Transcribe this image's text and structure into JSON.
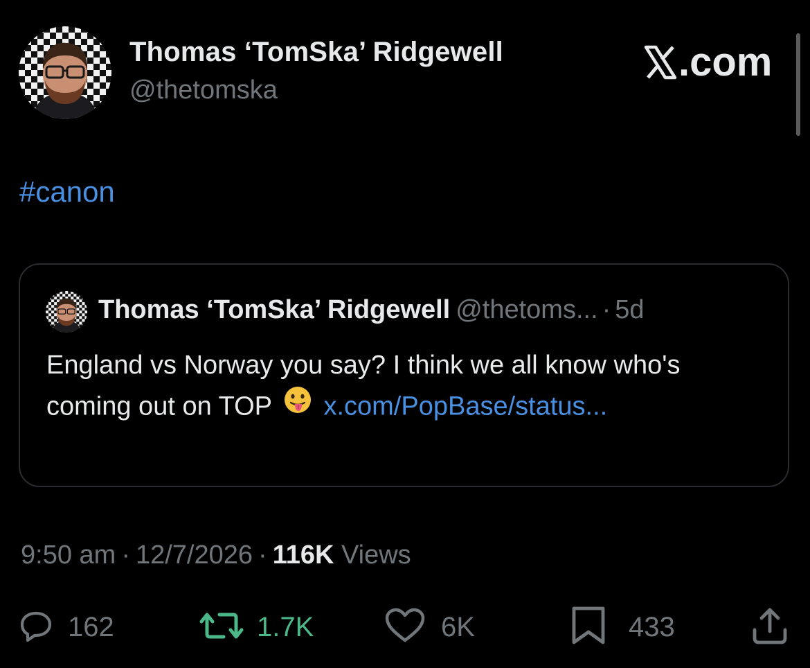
{
  "author": {
    "name": "Thomas ‘TomSka’ Ridgewell",
    "handle": "@thetomska"
  },
  "site_label": ".com",
  "post": {
    "text": "#canon"
  },
  "quoted_post": {
    "author_name": "Thomas ‘TomSka’ Ridgewell",
    "author_handle": "@thetoms...",
    "separator": "·",
    "time_ago": "5d",
    "text": "England vs Norway you say? I think we all know who's coming out on TOP",
    "emoji": "😛",
    "link_text": "x.com/PopBase/status..."
  },
  "meta": {
    "time": "9:50 am",
    "separator": "·",
    "date": "12/7/2026",
    "views_count": "116K",
    "views_label": "Views"
  },
  "actions": {
    "replies": "162",
    "reposts": "1.7K",
    "likes": "6K",
    "bookmarks": "433"
  },
  "icons": {
    "reply": "reply-icon",
    "repost": "repost-icon",
    "like": "heart-icon",
    "bookmark": "bookmark-icon",
    "share": "share-icon",
    "brand": "x-logo-icon"
  },
  "colors": {
    "background": "#000000",
    "text": "#e7e9ea",
    "muted": "#71767b",
    "link": "#4a90e2",
    "repost_active": "#4cb88a"
  }
}
